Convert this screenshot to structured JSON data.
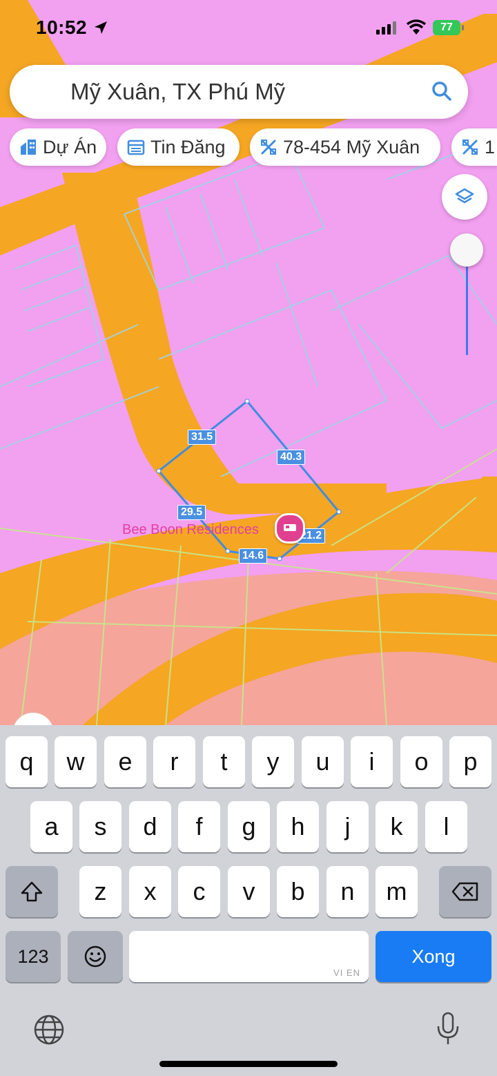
{
  "status_bar": {
    "time": "10:52",
    "battery": "77"
  },
  "search": {
    "value": "Mỹ Xuân, TX Phú Mỹ"
  },
  "chips": [
    {
      "label": "Dự Án",
      "icon": "building-icon"
    },
    {
      "label": "Tin Đăng",
      "icon": "listing-icon"
    },
    {
      "label": "78-454 Mỹ Xuân",
      "icon": "parcel-icon"
    },
    {
      "label": "1",
      "icon": "parcel-icon"
    }
  ],
  "map": {
    "measurements": [
      "31.5",
      "40.3",
      "29.5",
      "21.2",
      "14.6"
    ],
    "poi_name": "Bee Boon Residences",
    "colors": {
      "residential": "#f2a0f0",
      "road": "#f5a623",
      "salmon_zone": "#f5a59a",
      "lot_lines": "#9fd4e6",
      "measure": "#4a90e2",
      "poi": "#e0408f"
    }
  },
  "keyboard": {
    "row1": [
      "q",
      "w",
      "e",
      "r",
      "t",
      "y",
      "u",
      "i",
      "o",
      "p"
    ],
    "row2": [
      "a",
      "s",
      "d",
      "f",
      "g",
      "h",
      "j",
      "k",
      "l"
    ],
    "row3": [
      "z",
      "x",
      "c",
      "v",
      "b",
      "n",
      "m"
    ],
    "numbers_key": "123",
    "done_key": "Xong",
    "space_hint": "VI EN",
    "accent": "#1a7cf4"
  }
}
